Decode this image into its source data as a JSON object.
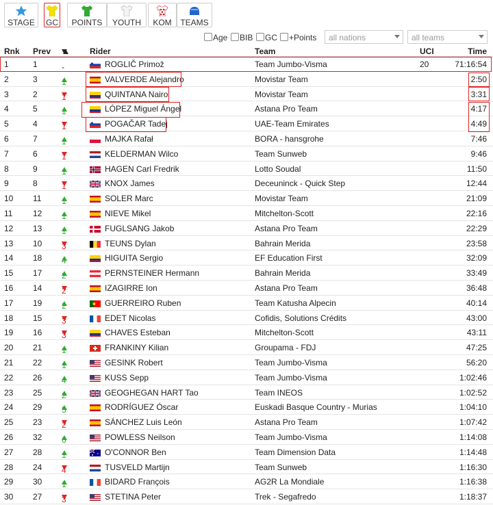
{
  "tabs": [
    {
      "label": "STAGE",
      "icon": "star-icon",
      "color": "#3399dd"
    },
    {
      "label": "GC",
      "icon": "yellow-jersey-icon",
      "color": "#f5e000"
    },
    {
      "label": "POINTS",
      "icon": "green-jersey-icon",
      "color": "#33aa33"
    },
    {
      "label": "YOUTH",
      "icon": "white-jersey-icon",
      "color": "#eeeeee"
    },
    {
      "label": "KOM",
      "icon": "polka-dot-jersey-icon",
      "color": "#cc2222"
    },
    {
      "label": "TEAMS",
      "icon": "team-helmet-icon",
      "color": "#2266cc"
    }
  ],
  "filters": {
    "age": "Age",
    "bib": "BIB",
    "gc": "GC",
    "points": "+Points",
    "nations": "all nations",
    "teams": "all teams"
  },
  "headers": {
    "rnk": "Rnk",
    "prev": "Prev",
    "rider": "Rider",
    "team": "Team",
    "uci": "UCI",
    "time": "Time"
  },
  "rows": [
    {
      "rnk": "1",
      "prev": "1",
      "dir": "none",
      "chg": "-",
      "flag": "SI",
      "rider": "ROGLIČ Primož",
      "team": "Team Jumbo-Visma",
      "uci": "20",
      "time": "71:16:54"
    },
    {
      "rnk": "2",
      "prev": "3",
      "dir": "up",
      "chg": "1",
      "flag": "ES",
      "rider": "VALVERDE Alejandro",
      "team": "Movistar Team",
      "uci": "",
      "time": "2:50"
    },
    {
      "rnk": "3",
      "prev": "2",
      "dir": "down",
      "chg": "1",
      "flag": "CO",
      "rider": "QUINTANA Nairo",
      "team": "Movistar Team",
      "uci": "",
      "time": "3:31"
    },
    {
      "rnk": "4",
      "prev": "5",
      "dir": "up",
      "chg": "1",
      "flag": "CO",
      "rider": "LÓPEZ Miguel Ángel",
      "team": "Astana Pro Team",
      "uci": "",
      "time": "4:17"
    },
    {
      "rnk": "5",
      "prev": "4",
      "dir": "down",
      "chg": "1",
      "flag": "SI",
      "rider": "POGAČAR Tadej",
      "team": "UAE-Team Emirates",
      "uci": "",
      "time": "4:49"
    },
    {
      "rnk": "6",
      "prev": "7",
      "dir": "up",
      "chg": "1",
      "flag": "PL",
      "rider": "MAJKA Rafał",
      "team": "BORA - hansgrohe",
      "uci": "",
      "time": "7:46"
    },
    {
      "rnk": "7",
      "prev": "6",
      "dir": "down",
      "chg": "1",
      "flag": "NL",
      "rider": "KELDERMAN Wilco",
      "team": "Team Sunweb",
      "uci": "",
      "time": "9:46"
    },
    {
      "rnk": "8",
      "prev": "9",
      "dir": "up",
      "chg": "1",
      "flag": "NO",
      "rider": "HAGEN Carl Fredrik",
      "team": "Lotto Soudal",
      "uci": "",
      "time": "11:50"
    },
    {
      "rnk": "9",
      "prev": "8",
      "dir": "down",
      "chg": "1",
      "flag": "GB",
      "rider": "KNOX James",
      "team": "Deceuninck - Quick Step",
      "uci": "",
      "time": "12:44"
    },
    {
      "rnk": "10",
      "prev": "11",
      "dir": "up",
      "chg": "1",
      "flag": "ES",
      "rider": "SOLER Marc",
      "team": "Movistar Team",
      "uci": "",
      "time": "21:09"
    },
    {
      "rnk": "11",
      "prev": "12",
      "dir": "up",
      "chg": "1",
      "flag": "ES",
      "rider": "NIEVE Mikel",
      "team": "Mitchelton-Scott",
      "uci": "",
      "time": "22:16"
    },
    {
      "rnk": "12",
      "prev": "13",
      "dir": "up",
      "chg": "1",
      "flag": "DK",
      "rider": "FUGLSANG Jakob",
      "team": "Astana Pro Team",
      "uci": "",
      "time": "22:29"
    },
    {
      "rnk": "13",
      "prev": "10",
      "dir": "down",
      "chg": "3",
      "flag": "BE",
      "rider": "TEUNS Dylan",
      "team": "Bahrain Merida",
      "uci": "",
      "time": "23:58"
    },
    {
      "rnk": "14",
      "prev": "18",
      "dir": "up",
      "chg": "4",
      "flag": "CO",
      "rider": "HIGUITA Sergio",
      "team": "EF Education First",
      "uci": "",
      "time": "32:09"
    },
    {
      "rnk": "15",
      "prev": "17",
      "dir": "up",
      "chg": "2",
      "flag": "AT",
      "rider": "PERNSTEINER Hermann",
      "team": "Bahrain Merida",
      "uci": "",
      "time": "33:49"
    },
    {
      "rnk": "16",
      "prev": "14",
      "dir": "down",
      "chg": "2",
      "flag": "ES",
      "rider": "IZAGIRRE Ion",
      "team": "Astana Pro Team",
      "uci": "",
      "time": "36:48"
    },
    {
      "rnk": "17",
      "prev": "19",
      "dir": "up",
      "chg": "2",
      "flag": "PT",
      "rider": "GUERREIRO Ruben",
      "team": "Team Katusha Alpecin",
      "uci": "",
      "time": "40:14"
    },
    {
      "rnk": "18",
      "prev": "15",
      "dir": "down",
      "chg": "3",
      "flag": "FR",
      "rider": "EDET Nicolas",
      "team": "Cofidis, Solutions Crédits",
      "uci": "",
      "time": "43:00"
    },
    {
      "rnk": "19",
      "prev": "16",
      "dir": "down",
      "chg": "3",
      "flag": "CO",
      "rider": "CHAVES Esteban",
      "team": "Mitchelton-Scott",
      "uci": "",
      "time": "43:11"
    },
    {
      "rnk": "20",
      "prev": "21",
      "dir": "up",
      "chg": "1",
      "flag": "CH",
      "rider": "FRANKINY Kilian",
      "team": "Groupama - FDJ",
      "uci": "",
      "time": "47:25"
    },
    {
      "rnk": "21",
      "prev": "22",
      "dir": "up",
      "chg": "1",
      "flag": "US",
      "rider": "GESINK Robert",
      "team": "Team Jumbo-Visma",
      "uci": "",
      "time": "56:20"
    },
    {
      "rnk": "22",
      "prev": "26",
      "dir": "up",
      "chg": "4",
      "flag": "US",
      "rider": "KUSS Sepp",
      "team": "Team Jumbo-Visma",
      "uci": "",
      "time": "1:02:46"
    },
    {
      "rnk": "23",
      "prev": "25",
      "dir": "up",
      "chg": "2",
      "flag": "GB",
      "rider": "GEOGHEGAN HART Tao",
      "team": "Team INEOS",
      "uci": "",
      "time": "1:02:52"
    },
    {
      "rnk": "24",
      "prev": "29",
      "dir": "up",
      "chg": "5",
      "flag": "ES",
      "rider": "RODRÍGUEZ Óscar",
      "team": "Euskadi Basque Country - Murias",
      "uci": "",
      "time": "1:04:10"
    },
    {
      "rnk": "25",
      "prev": "23",
      "dir": "down",
      "chg": "2",
      "flag": "ES",
      "rider": "SÁNCHEZ Luis León",
      "team": "Astana Pro Team",
      "uci": "",
      "time": "1:07:42"
    },
    {
      "rnk": "26",
      "prev": "32",
      "dir": "up",
      "chg": "6",
      "flag": "US",
      "rider": "POWLESS Neilson",
      "team": "Team Jumbo-Visma",
      "uci": "",
      "time": "1:14:08"
    },
    {
      "rnk": "27",
      "prev": "28",
      "dir": "up",
      "chg": "1",
      "flag": "AU",
      "rider": "O'CONNOR Ben",
      "team": "Team Dimension Data",
      "uci": "",
      "time": "1:14:48"
    },
    {
      "rnk": "28",
      "prev": "24",
      "dir": "down",
      "chg": "4",
      "flag": "NL",
      "rider": "TUSVELD Martijn",
      "team": "Team Sunweb",
      "uci": "",
      "time": "1:16:30"
    },
    {
      "rnk": "29",
      "prev": "30",
      "dir": "up",
      "chg": "1",
      "flag": "FR",
      "rider": "BIDARD François",
      "team": "AG2R La Mondiale",
      "uci": "",
      "time": "1:16:38"
    },
    {
      "rnk": "30",
      "prev": "27",
      "dir": "down",
      "chg": "3",
      "flag": "US",
      "rider": "STETINA Peter",
      "team": "Trek - Segafredo",
      "uci": "",
      "time": "1:18:37"
    }
  ]
}
